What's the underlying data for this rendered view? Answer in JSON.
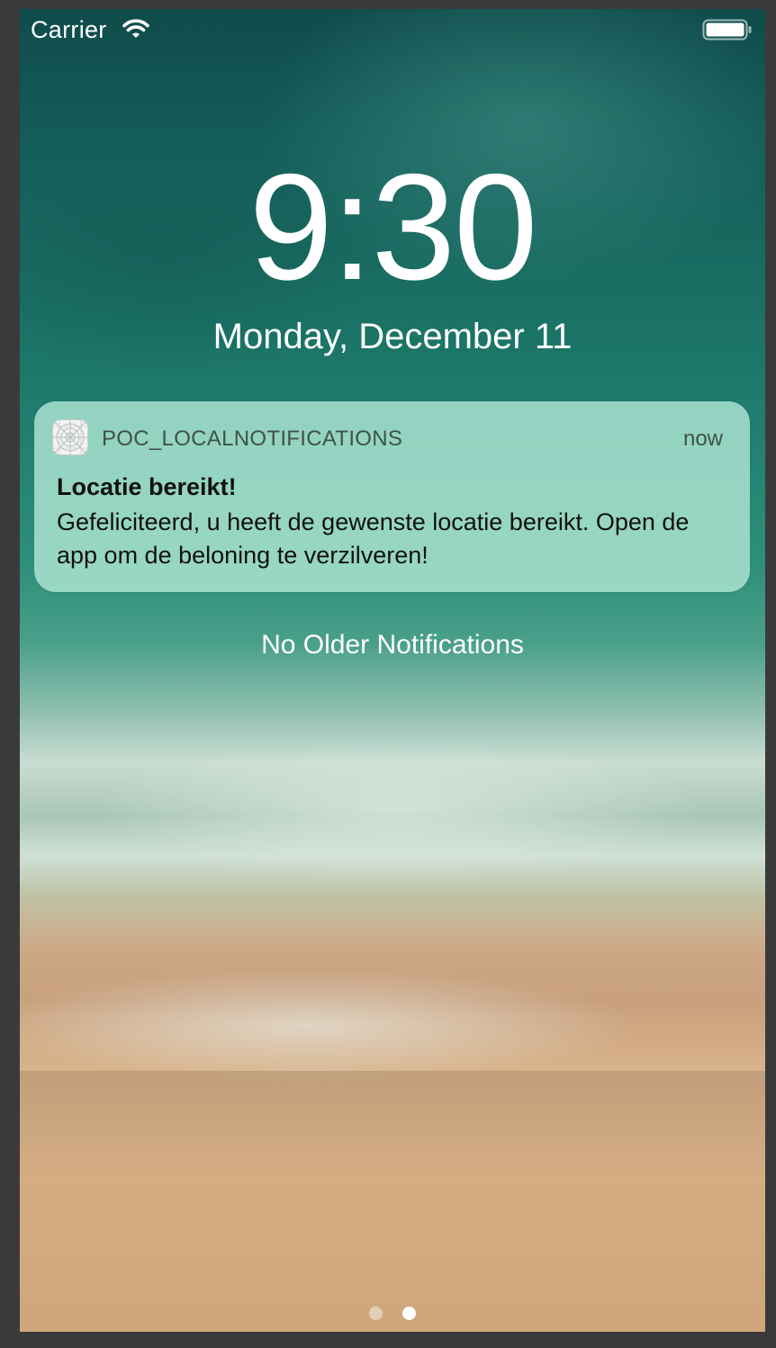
{
  "status_bar": {
    "carrier": "Carrier",
    "wifi_icon": "wifi-icon",
    "battery_icon": "battery-full-icon"
  },
  "lock_screen": {
    "time": "9:30",
    "date": "Monday, December 11"
  },
  "notification": {
    "app_icon": "app-placeholder-icon",
    "app_name": "POC_LOCALNOTIFICATIONS",
    "time": "now",
    "title": "Locatie bereikt!",
    "body": "Gefeliciteerd, u heeft de gewenste locatie bereikt. Open de app om de beloning te verzilveren!"
  },
  "no_older_notifications": "No Older Notifications",
  "page_indicator": {
    "pages": 2,
    "current_page": 2
  },
  "colors": {
    "notification_background": "#b2e8d6",
    "text_light": "#ffffff",
    "frame_background": "#3a3a3c"
  }
}
